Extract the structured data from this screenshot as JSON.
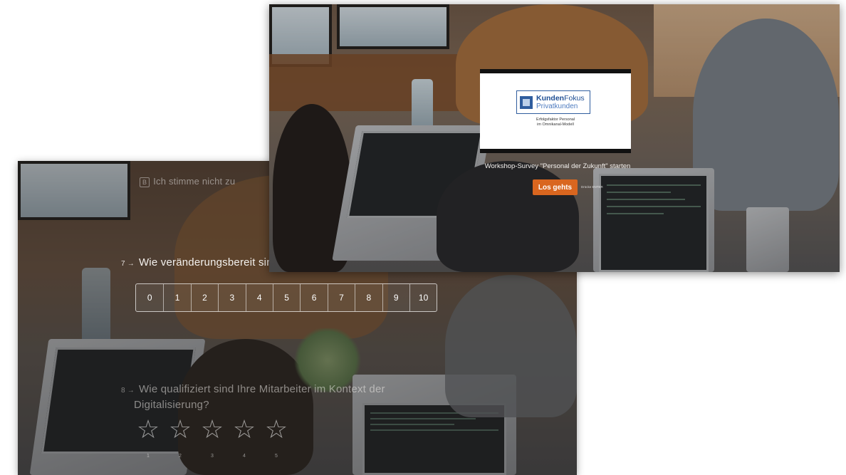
{
  "back_screen": {
    "prev_option_a_key": "",
    "prev_option_a_text": "",
    "prev_option_b_key": "B",
    "prev_option_b_text": "Ich stimme nicht zu",
    "question7": {
      "number": "7 →",
      "text": "Wie veränderungsbereit sin"
    },
    "scale": [
      "0",
      "1",
      "2",
      "3",
      "4",
      "5",
      "6",
      "7",
      "8",
      "9",
      "10"
    ],
    "question8": {
      "number": "8 →",
      "line1": "Wie qualifiziert sind Ihre Mitarbeiter im Kontext der",
      "line2": "Digitalisierung?"
    },
    "stars": [
      "1",
      "2",
      "3",
      "4",
      "5"
    ]
  },
  "front_screen": {
    "logo": {
      "brand_bold": "Kunden",
      "brand_rest": "Fokus",
      "line2": "Privatkunden",
      "sub1": "Erfolgsfaktor Personal",
      "sub2": "im Omnikanal-Modell"
    },
    "start_label": "Workshop-Survey \"Personal der Zukunft\" starten",
    "start_button": "Los gehts",
    "enter_hint": "Drücke ENTER"
  },
  "colors": {
    "accent_button": "#d9661f",
    "logo_blue": "#2f5d9e"
  }
}
